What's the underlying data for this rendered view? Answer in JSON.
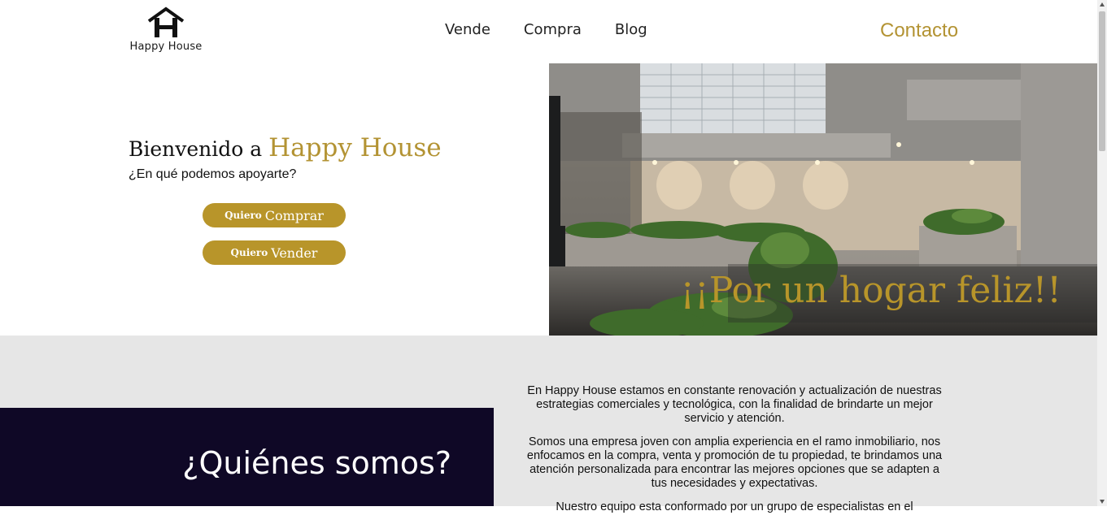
{
  "header": {
    "logo_text": "Happy House",
    "nav": [
      "Vende",
      "Compra",
      "Blog"
    ],
    "contact": "Contacto"
  },
  "hero": {
    "title_prefix": "Bienvenido a",
    "title_brand": "Happy House",
    "subtitle": "¿En qué podemos apoyarte?",
    "buy_small": "Quiero",
    "buy_big": "Comprar",
    "sell_small": "Quiero",
    "sell_big": "Vender",
    "slogan": "¡¡Por un hogar feliz!!"
  },
  "about": {
    "title": "¿Quiénes somos?",
    "paragraphs": [
      "En Happy House estamos en constante renovación y actualización de nuestras estrategias comerciales y tecnológica, con la finalidad de brindarte un mejor servicio y atención.",
      "Somos una empresa joven con amplia experiencia en el ramo inmobiliario, nos enfocamos en la compra, venta y promoción de tu propiedad, te brindamos una atención personalizada para encontrar las mejores opciones que se adapten a tus necesidades y expectativas.",
      "Nuestro equipo esta conformado por un grupo de especialistas en el"
    ]
  },
  "colors": {
    "accent": "#b8952a",
    "dark_panel": "#0f0826",
    "section_bg": "#e6e6e6"
  }
}
